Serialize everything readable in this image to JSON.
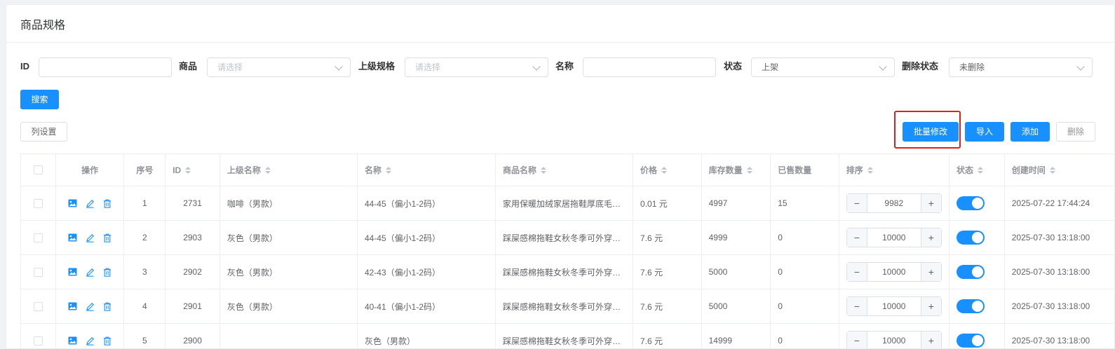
{
  "page": {
    "title": "商品规格"
  },
  "filters": {
    "id_label": "ID",
    "id_value": "",
    "product_label": "商品",
    "product_placeholder": "请选择",
    "parent_label": "上级规格",
    "parent_placeholder": "请选择",
    "name_label": "名称",
    "name_value": "",
    "status_label": "状态",
    "status_value": "上架",
    "deleted_label": "删除状态",
    "deleted_value": "未删除"
  },
  "actions": {
    "search": "搜索",
    "column_settings": "列设置",
    "batch_edit": "批量修改",
    "import": "导入",
    "add": "添加",
    "delete": "删除"
  },
  "table": {
    "headers": {
      "ops": "操作",
      "index": "序号",
      "id": "ID",
      "parent_name": "上级名称",
      "name": "名称",
      "product_name": "商品名称",
      "price": "价格",
      "stock": "库存数量",
      "sold": "已售数量",
      "sort": "排序",
      "status": "状态",
      "created": "创建时间"
    },
    "rows": [
      {
        "index": "1",
        "id": "2731",
        "parent_name": "咖啡（男款）",
        "name": "44-45（偏小1-2码）",
        "product_name": "家用保暖加绒家居拖鞋厚底毛…",
        "price": "0.01 元",
        "stock": "4997",
        "sold": "15",
        "sort": "9982",
        "status": true,
        "created": "2025-07-22 17:44:24"
      },
      {
        "index": "2",
        "id": "2903",
        "parent_name": "灰色（男款）",
        "name": "44-45（偏小1-2码）",
        "product_name": "踩屎感棉拖鞋女秋冬季可外穿…",
        "price": "7.6 元",
        "stock": "4999",
        "sold": "0",
        "sort": "10000",
        "status": true,
        "created": "2025-07-30 13:18:00"
      },
      {
        "index": "3",
        "id": "2902",
        "parent_name": "灰色（男款）",
        "name": "42-43（偏小1-2码）",
        "product_name": "踩屎感棉拖鞋女秋冬季可外穿…",
        "price": "7.6 元",
        "stock": "5000",
        "sold": "0",
        "sort": "10000",
        "status": true,
        "created": "2025-07-30 13:18:00"
      },
      {
        "index": "4",
        "id": "2901",
        "parent_name": "灰色（男款）",
        "name": "40-41（偏小1-2码）",
        "product_name": "踩屎感棉拖鞋女秋冬季可外穿…",
        "price": "7.6 元",
        "stock": "5000",
        "sold": "0",
        "sort": "10000",
        "status": true,
        "created": "2025-07-30 13:18:00"
      },
      {
        "index": "5",
        "id": "2900",
        "parent_name": "",
        "name": "灰色（男款）",
        "product_name": "踩屎感棉拖鞋女秋冬季可外穿…",
        "price": "7.6 元",
        "stock": "14999",
        "sold": "0",
        "sort": "10000",
        "status": true,
        "created": "2025-07-30 13:18:00"
      }
    ]
  },
  "icons": {
    "image": "image-icon",
    "edit": "edit-icon",
    "delete": "delete-icon"
  },
  "colors": {
    "primary": "#1890ff",
    "highlight": "#e0201b"
  }
}
